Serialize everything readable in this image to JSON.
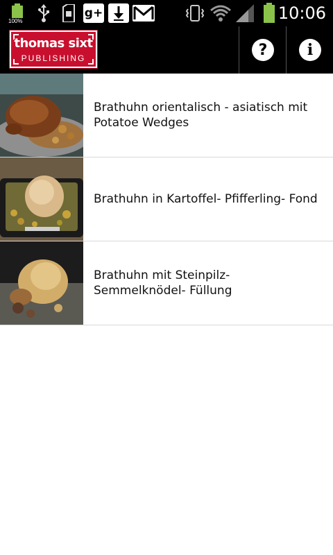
{
  "status_bar": {
    "battery_small_percent": "100%",
    "time": "10:06",
    "icons": [
      "battery-icon",
      "usb-icon",
      "sd-card-icon",
      "google-plus-icon",
      "download-icon",
      "gmail-icon",
      "vibrate-icon",
      "wifi-icon",
      "signal-icon",
      "battery-icon"
    ]
  },
  "action_bar": {
    "logo_title": "thomas sixt",
    "logo_subtitle": "PUBLISHING",
    "help_glyph": "?",
    "info_glyph": "i",
    "brand_color": "#c8102e"
  },
  "recipes": [
    {
      "title": "Brathuhn orientalisch - asiatisch mit Potatoe Wedges",
      "image": "roast-chicken-photo"
    },
    {
      "title": "Brathuhn in Kartoffel- Pfifferling- Fond",
      "image": "roast-chicken-in-pan-photo"
    },
    {
      "title": "Brathuhn mit Steinpilz- Semmelknödel- Füllung",
      "image": "stuffed-roast-chicken-photo"
    }
  ]
}
